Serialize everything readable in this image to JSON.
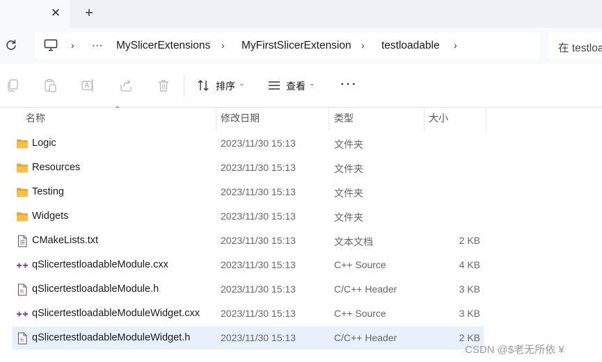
{
  "tab": {
    "close_glyph": "✕",
    "new_glyph": "+"
  },
  "breadcrumb": {
    "overflow": "···",
    "items": [
      "MySlicerExtensions",
      "MyFirstSlicerExtension",
      "testloadable"
    ],
    "sep": "›"
  },
  "search": {
    "text": "在 testloa"
  },
  "toolbar": {
    "sort_label": "排序",
    "view_label": "查看",
    "more_label": "···",
    "chevron": "⌄",
    "icons": [
      "copy-icon",
      "paste-icon",
      "rename-icon",
      "share-icon",
      "delete-icon"
    ]
  },
  "columns": {
    "name": "名称",
    "date": "修改日期",
    "type": "类型",
    "size": "大小",
    "sort_arrow": "⌃"
  },
  "files": [
    {
      "name": "Logic",
      "date": "2023/11/30 15:13",
      "type": "文件夹",
      "size": "",
      "icon": "folder-icon"
    },
    {
      "name": "Resources",
      "date": "2023/11/30 15:13",
      "type": "文件夹",
      "size": "",
      "icon": "folder-icon"
    },
    {
      "name": "Testing",
      "date": "2023/11/30 15:13",
      "type": "文件夹",
      "size": "",
      "icon": "folder-icon"
    },
    {
      "name": "Widgets",
      "date": "2023/11/30 15:13",
      "type": "文件夹",
      "size": "",
      "icon": "folder-icon"
    },
    {
      "name": "CMakeLists.txt",
      "date": "2023/11/30 15:13",
      "type": "文本文档",
      "size": "2 KB",
      "icon": "text-file-icon"
    },
    {
      "name": "qSlicertestloadableModule.cxx",
      "date": "2023/11/30 15:13",
      "type": "C++ Source",
      "size": "4 KB",
      "icon": "cpp-source-icon"
    },
    {
      "name": "qSlicertestloadableModule.h",
      "date": "2023/11/30 15:13",
      "type": "C/C++ Header",
      "size": "3 KB",
      "icon": "header-file-icon"
    },
    {
      "name": "qSlicertestloadableModuleWidget.cxx",
      "date": "2023/11/30 15:13",
      "type": "C++ Source",
      "size": "3 KB",
      "icon": "cpp-source-icon"
    },
    {
      "name": "qSlicertestloadableModuleWidget.h",
      "date": "2023/11/30 15:13",
      "type": "C/C++ Header",
      "size": "2 KB",
      "icon": "header-file-icon",
      "selected": true
    }
  ],
  "watermark": "CSDN @$老无所依 ¥",
  "colors": {
    "folder": "#f5c04a",
    "folder_dark": "#e6a82a",
    "selected_row": "#e7f0fb",
    "cpp_accent": "#8a3fb5"
  }
}
